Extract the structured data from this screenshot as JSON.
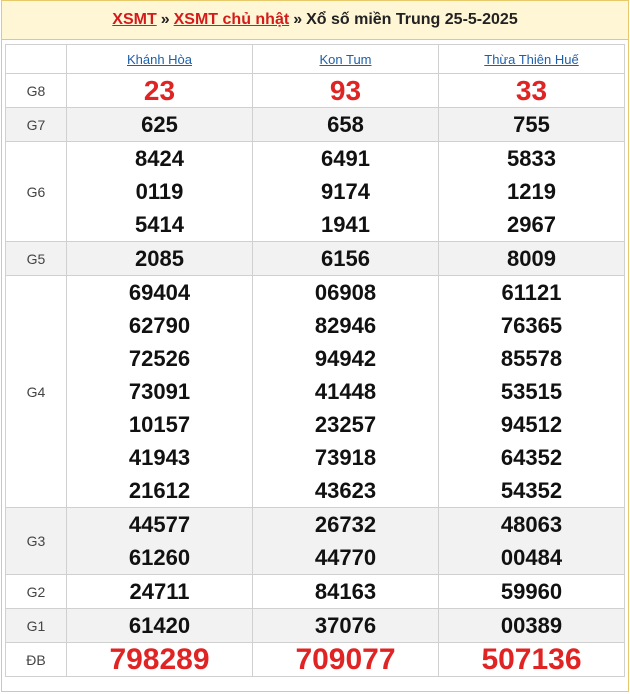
{
  "breadcrumb": {
    "link1": "XSMT",
    "sep1": "»",
    "link2": "XSMT chủ nhật",
    "sep2": "»",
    "current": "Xổ số miền Trung 25-5-2025"
  },
  "provinces": [
    "Khánh Hòa",
    "Kon Tum",
    "Thừa Thiên Huế"
  ],
  "prizes": [
    {
      "label": "G8",
      "values": [
        [
          "23"
        ],
        [
          "93"
        ],
        [
          "33"
        ]
      ]
    },
    {
      "label": "G7",
      "values": [
        [
          "625"
        ],
        [
          "658"
        ],
        [
          "755"
        ]
      ]
    },
    {
      "label": "G6",
      "values": [
        [
          "8424",
          "0119",
          "5414"
        ],
        [
          "6491",
          "9174",
          "1941"
        ],
        [
          "5833",
          "1219",
          "2967"
        ]
      ]
    },
    {
      "label": "G5",
      "values": [
        [
          "2085"
        ],
        [
          "6156"
        ],
        [
          "8009"
        ]
      ]
    },
    {
      "label": "G4",
      "values": [
        [
          "69404",
          "62790",
          "72526",
          "73091",
          "10157",
          "41943",
          "21612"
        ],
        [
          "06908",
          "82946",
          "94942",
          "41448",
          "23257",
          "73918",
          "43623"
        ],
        [
          "61121",
          "76365",
          "85578",
          "53515",
          "94512",
          "64352",
          "54352"
        ]
      ]
    },
    {
      "label": "G3",
      "values": [
        [
          "44577",
          "61260"
        ],
        [
          "26732",
          "44770"
        ],
        [
          "48063",
          "00484"
        ]
      ]
    },
    {
      "label": "G2",
      "values": [
        [
          "24711"
        ],
        [
          "84163"
        ],
        [
          "59960"
        ]
      ]
    },
    {
      "label": "G1",
      "values": [
        [
          "61420"
        ],
        [
          "37076"
        ],
        [
          "00389"
        ]
      ]
    },
    {
      "label": "ĐB",
      "values": [
        [
          "798289"
        ],
        [
          "709077"
        ],
        [
          "507136"
        ]
      ]
    }
  ]
}
